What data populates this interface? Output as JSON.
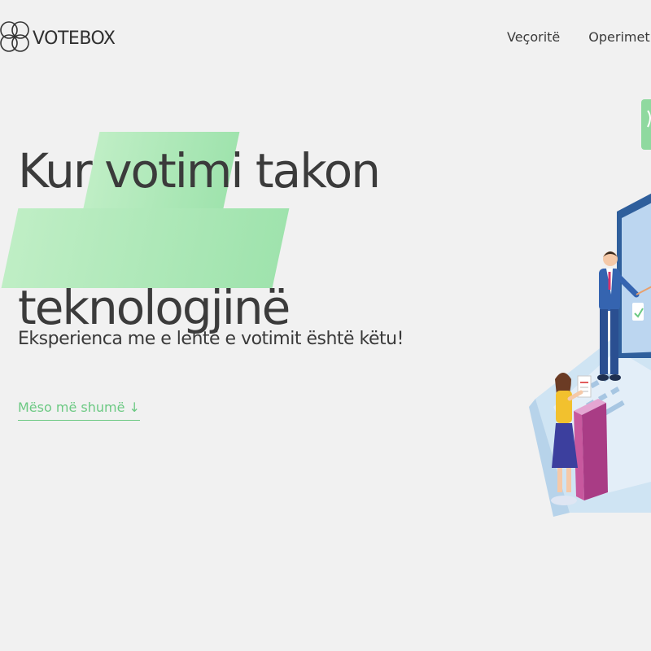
{
  "header": {
    "brand": "VOTEBOX",
    "nav": [
      {
        "label": "Veçoritë"
      },
      {
        "label": "Operimet"
      }
    ]
  },
  "hero": {
    "title_parts": [
      "Kur ",
      "votimi",
      " takon"
    ],
    "title_line2": "teknologjinë",
    "subtitle": "Eksperienca me e lehtë e votimit është këtu!",
    "cta": "Mëso më shumë ↓"
  },
  "colors": {
    "accent": "#6cc983",
    "highlight": "#a8e6b5",
    "text": "#3b3b3b",
    "background": "#f1f1f1"
  }
}
